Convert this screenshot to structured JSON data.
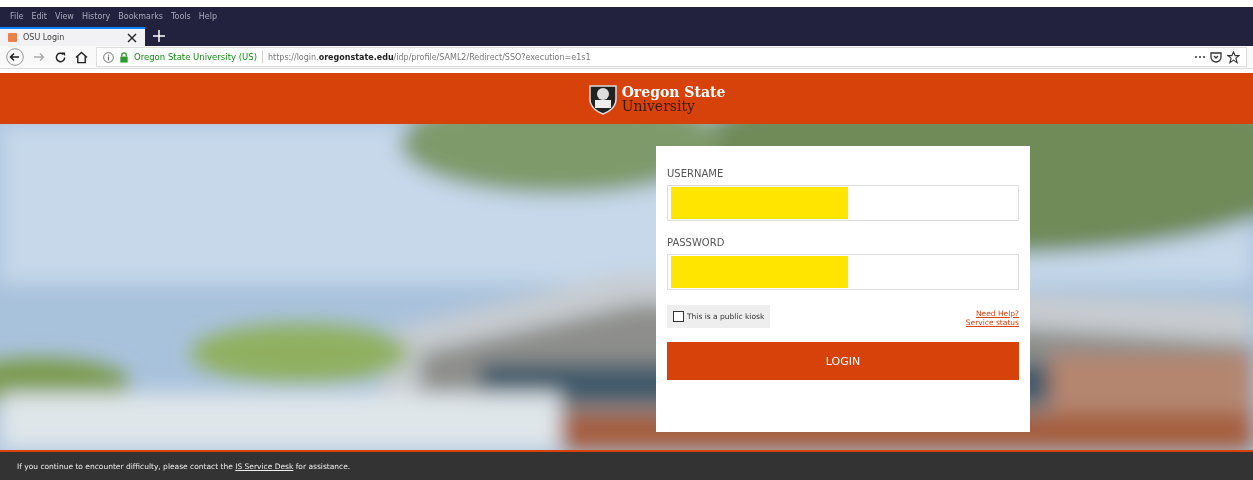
{
  "menu_bar": [
    "File",
    "Edit",
    "View",
    "History",
    "Bookmarks",
    "Tools",
    "Help"
  ],
  "tabs": [
    {
      "label": "OSU Login",
      "selected": true
    }
  ],
  "address_bar": {
    "site_identity": "Oregon State University (US)",
    "url_prefix": "https://login.",
    "url_domain": "oregonstate.edu",
    "url_path": "/idp/profile/SAML2/Redirect/SSO?execution=e1s1"
  },
  "header": {
    "logo_line_1": "Oregon State",
    "logo_line_2": "University"
  },
  "login_form": {
    "fields": [
      {
        "label": "USERNAME",
        "redacted": true
      },
      {
        "label": "PASSWORD",
        "redacted": true
      }
    ],
    "kiosk_checkbox": {
      "label": "This is a public kiosk",
      "checked": false
    },
    "links": [
      "Need Help?",
      "Service status"
    ],
    "login_button": "LOGIN"
  },
  "footer": {
    "before": "If you continue to encounter difficulty, please contact the ",
    "link": "IS Service Desk",
    "after": " for assistance."
  }
}
